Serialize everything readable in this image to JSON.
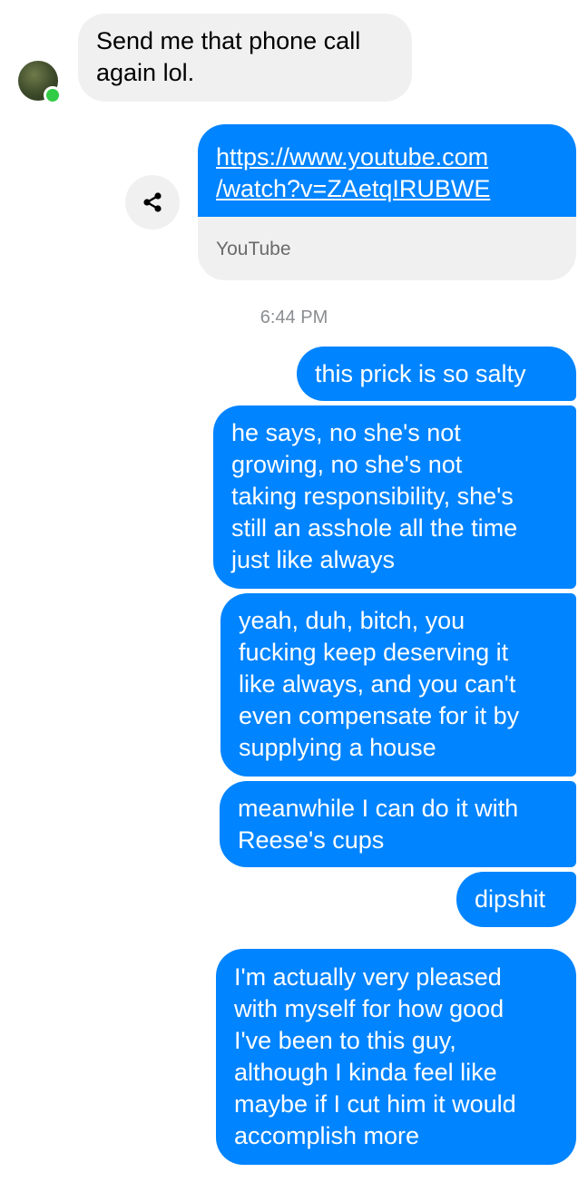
{
  "conversation": {
    "incoming": [
      {
        "lines": [
          "Send me that phone call",
          "again lol."
        ]
      }
    ],
    "shared_link": {
      "url_lines": [
        "https://www.youtube.com",
        "/watch?v=ZAetqIRUBWE"
      ],
      "source": "YouTube"
    },
    "timestamp": "6:44 PM",
    "outgoing": [
      {
        "lines": [
          "this prick is so salty"
        ]
      },
      {
        "lines": [
          "he says, no she's not",
          "growing, no she's not",
          "taking responsibility, she's",
          "still an asshole all the time",
          "just like always"
        ]
      },
      {
        "lines": [
          "yeah, duh, bitch, you",
          "fucking keep deserving it",
          "like always, and you can't",
          "even compensate for it by",
          "supplying a house"
        ]
      },
      {
        "lines": [
          "meanwhile I can do it with",
          "Reese's cups"
        ]
      },
      {
        "lines": [
          "dipshit"
        ]
      },
      {
        "lines": [
          "I'm actually very pleased",
          "with myself for how good",
          "I've been to this guy,",
          "although I kinda feel like",
          "maybe if I cut him it would",
          "accomplish more"
        ]
      }
    ]
  },
  "icons": {
    "avatar": "contact-avatar",
    "online": "online-status-dot",
    "share": "share-icon"
  },
  "colors": {
    "outgoing_bubble": "#0084ff",
    "incoming_bubble": "#f1f0f0",
    "online_dot": "#31cc46"
  }
}
